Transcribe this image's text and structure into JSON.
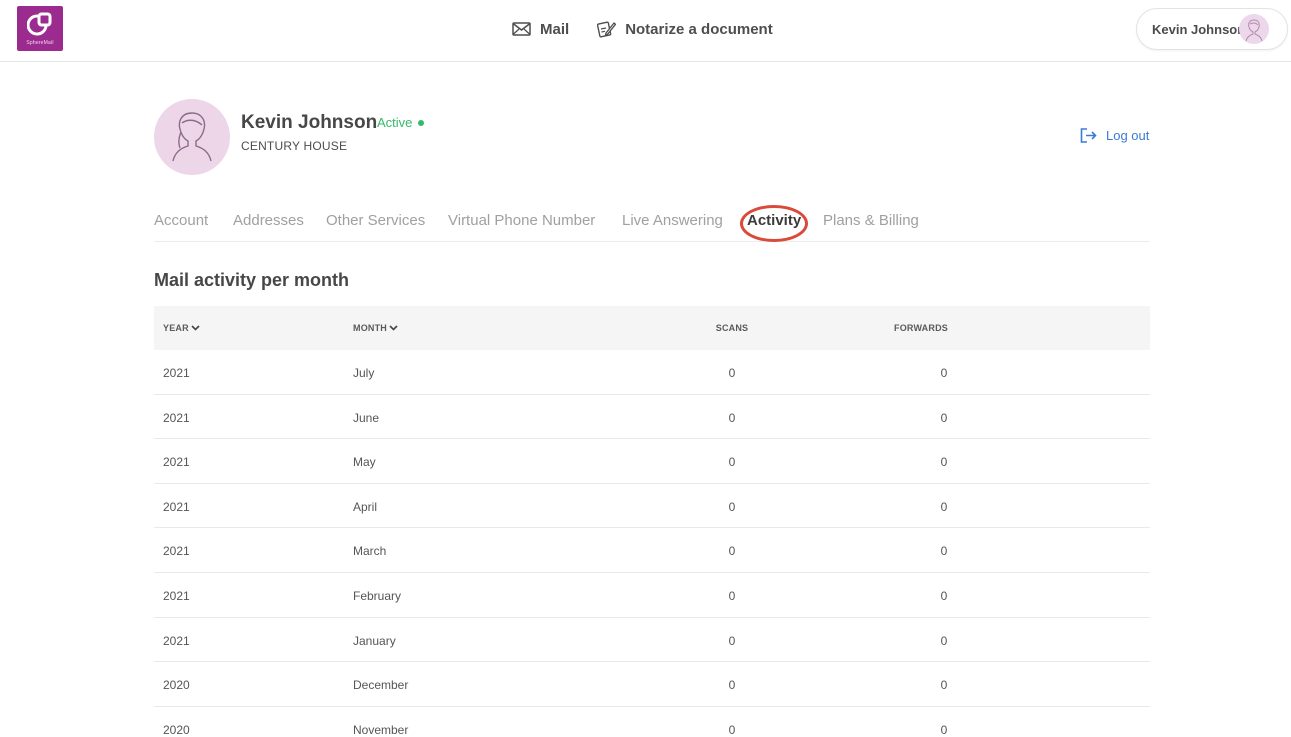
{
  "brand": {
    "name": "SphereMail",
    "color": "#9c2b8f"
  },
  "topnav": {
    "mail_label": "Mail",
    "notarize_label": "Notarize a document"
  },
  "user_menu": {
    "name": "Kevin Johnson"
  },
  "profile": {
    "name": "Kevin Johnson",
    "status": "Active",
    "company": "CENTURY HOUSE"
  },
  "logout_label": "Log out",
  "tabs": [
    {
      "label": "Account"
    },
    {
      "label": "Addresses"
    },
    {
      "label": "Other Services"
    },
    {
      "label": "Virtual Phone Number"
    },
    {
      "label": "Live Answering"
    },
    {
      "label": "Activity",
      "active": true
    },
    {
      "label": "Plans & Billing"
    }
  ],
  "section_title": "Mail activity per month",
  "table": {
    "columns": {
      "year": "YEAR",
      "month": "MONTH",
      "scans": "SCANS",
      "forwards": "FORWARDS"
    },
    "rows": [
      {
        "year": "2021",
        "month": "July",
        "scans": "0",
        "forwards": "0"
      },
      {
        "year": "2021",
        "month": "June",
        "scans": "0",
        "forwards": "0"
      },
      {
        "year": "2021",
        "month": "May",
        "scans": "0",
        "forwards": "0"
      },
      {
        "year": "2021",
        "month": "April",
        "scans": "0",
        "forwards": "0"
      },
      {
        "year": "2021",
        "month": "March",
        "scans": "0",
        "forwards": "0"
      },
      {
        "year": "2021",
        "month": "February",
        "scans": "0",
        "forwards": "0"
      },
      {
        "year": "2021",
        "month": "January",
        "scans": "0",
        "forwards": "0"
      },
      {
        "year": "2020",
        "month": "December",
        "scans": "0",
        "forwards": "0"
      },
      {
        "year": "2020",
        "month": "November",
        "scans": "0",
        "forwards": "0"
      }
    ]
  },
  "colors": {
    "accent_link": "#3a7bd5",
    "status_active": "#35b96b",
    "highlight_ring": "#d94a3a"
  }
}
